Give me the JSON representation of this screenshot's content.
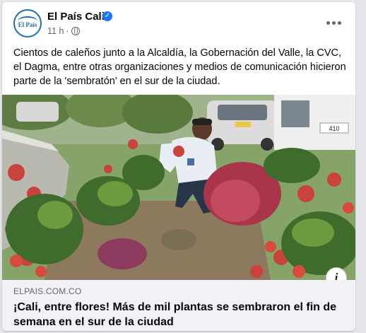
{
  "page": {
    "name": "El País Cali",
    "avatar_text": "El País",
    "timestamp": "11 h",
    "separator": "·",
    "verified_glyph": "✓"
  },
  "post": {
    "text": "Cientos de caleños junto a la Alcaldía, la Gobernación del Valle, la CVC, el Dagma, entre otras organizaciones y medios de comunicación hicieron parte de la 'sembratón' en el sur de la ciudad."
  },
  "photo": {
    "vehicle_plate": "410"
  },
  "link": {
    "domain": "ELPAIS.COM.CO",
    "title": "¡Cali, entre flores! Más de mil plantas se sembraron el fin de semana en el sur de la ciudad",
    "info_glyph": "i"
  },
  "icons": {
    "verified": "verified-badge-icon",
    "globe": "globe-icon",
    "more": "more-options-icon",
    "info": "info-icon"
  },
  "colors": {
    "verified_blue": "#1877f2",
    "meta_gray": "#65676b",
    "footer_bg": "#f0f2f5",
    "logo_blue": "#1a6fb5"
  }
}
